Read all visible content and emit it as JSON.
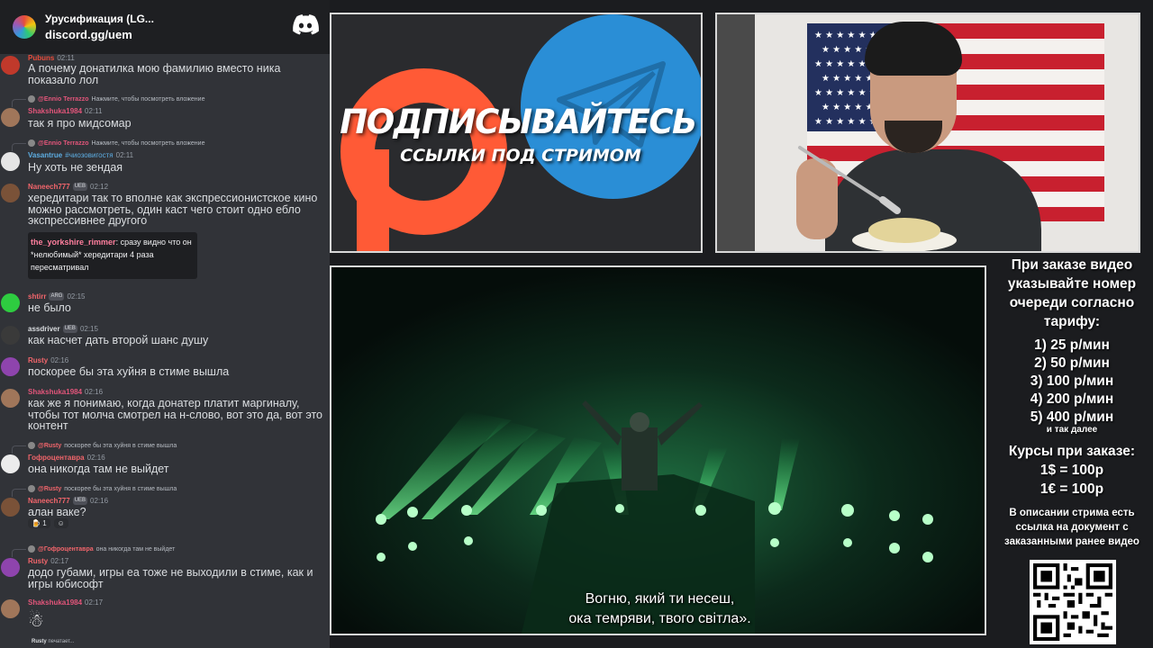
{
  "chat": {
    "server_name": "Урусификация (LG...",
    "server_link": "discord.gg/uem",
    "messages": [
      {
        "user": "Pubuns",
        "time": "02:11",
        "user_color": "#e74c3c",
        "text": "А почему донатилка мою фамилию вместо ника показало лол"
      },
      {
        "reply_user": "@Ennio Terrazzo",
        "reply_text": "Нажмите, чтобы посмотреть вложение",
        "user": "Shakshuka1984",
        "time": "02:11",
        "user_color": "#e2557a",
        "text": "так я про мидсомар"
      },
      {
        "reply_user": "@Ennio Terrazzo",
        "reply_text": "Нажмите, чтобы посмотреть вложение",
        "user": "Vasantrue",
        "tag": "#чиозовигостя",
        "time": "02:11",
        "user_color": "#5dade2",
        "text": "Ну хоть не зендая"
      },
      {
        "user": "Naneech777",
        "badge": "UEB",
        "time": "02:12",
        "user_color": "#f1656b",
        "text": "хередитари так то вполне как экспрессионистское кино можно рассмотреть, один каст чего стоит одно ебло экспрессивнее другого"
      },
      {
        "user": "shtirr",
        "badge": "ARG",
        "time": "02:15",
        "user_color": "#f1656b",
        "text": "не было"
      },
      {
        "user": "assdriver",
        "badge": "UEB",
        "time": "02:15",
        "user_color": "#dbdee1",
        "text": "как насчет дать второй шанс душу"
      },
      {
        "user": "Rusty",
        "time": "02:16",
        "user_color": "#f1656b",
        "text": "поскорее бы эта хуйня в стиме вышла"
      },
      {
        "user": "Shakshuka1984",
        "time": "02:16",
        "user_color": "#e2557a",
        "text": "как же я понимаю, когда донатер платит маргиналу, чтобы тот молча смотрел на н-слово, вот это да, вот это контент"
      },
      {
        "reply_user": "@Rusty",
        "reply_text": "поскорее бы эта хуйня в стиме вышла",
        "user": "Гофроцентавра",
        "time": "02:16",
        "user_color": "#f1656b",
        "text": "она никогда там не выйдет"
      },
      {
        "reply_user": "@Rusty",
        "reply_text": "поскорее бы эта хуйня в стиме вышла",
        "user": "Naneech777",
        "badge": "UEB",
        "time": "02:16",
        "user_color": "#f1656b",
        "text": "алан ваке?"
      },
      {
        "reply_user": "@Гофроцентавра",
        "reply_text": "она никогда там не выйдет",
        "user": "Rusty",
        "time": "02:17",
        "user_color": "#f1656b",
        "text": "додо губами, игры еа тоже не выходили в стиме, как и игры юбисофт"
      },
      {
        "user": "Shakshuka1984",
        "time": "02:17",
        "user_color": "#e2557a",
        "text": ""
      }
    ],
    "twitch_quote": {
      "user": "the_yorkshire_rimmer",
      "text": "сразу видно что он *нелюбимый* хередитари 4 раза пересматривал"
    },
    "reactions": [
      {
        "count": "1"
      }
    ],
    "typing": {
      "user": "Rusty",
      "text": "печатает..."
    }
  },
  "banner": {
    "title": "ПОДПИСЫВАЙТЕСЬ",
    "subtitle": "ССЫЛКИ ПОД СТРИМОМ"
  },
  "video": {
    "subtitle_line1": "Вогню, який ти несеш,",
    "subtitle_line2": "ока темряви, твого світла»."
  },
  "info": {
    "heading": "При заказе видео указывайте номер очереди согласно тарифу:",
    "tariffs": [
      "1) 25 р/мин",
      "2) 50 р/мин",
      "3) 100 р/мин",
      "4) 200 р/мин",
      "5) 400 р/мин"
    ],
    "tariffs_note": "и так далее",
    "rates_title": "Курсы при заказе:",
    "rates": [
      "1$ = 100р",
      "1€ = 100р"
    ],
    "description": "В описании стрима есть ссылка на документ с заказанными ранее видео"
  },
  "colors": {
    "discord_bg": "#313338",
    "patreon": "#ff5a36",
    "telegram": "#2a8ed6",
    "stage_green": "#2ee06a"
  }
}
